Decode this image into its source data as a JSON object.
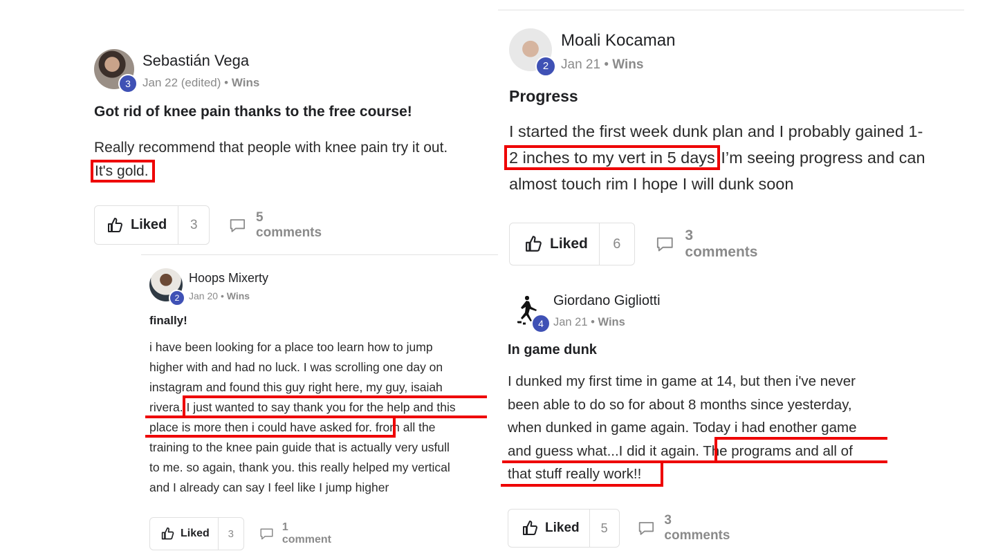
{
  "posts": [
    {
      "author": "Sebastián Vega",
      "level": "3",
      "date": "Jan 22 (edited)",
      "category": "Wins",
      "title": "Got rid of knee pain thanks to the free course!",
      "body_line1": "Really recommend that people with knee pain try it out.",
      "body_highlight": "It's gold.",
      "like_label": "Liked",
      "like_count": "3",
      "comments": "5 comments"
    },
    {
      "author": "Hoops Mixerty",
      "level": "2",
      "date": "Jan 20",
      "category": "Wins",
      "title": "finally!",
      "body_lines": [
        "i have been looking for a place too learn how to jump",
        "higher with and had no luck. I was scrolling one day on",
        "instagram and found this guy right here, my guy, isaiah"
      ],
      "body_l4_pre": "rivera.",
      "body_l4_hl": " I just wanted to say thank you for the help and this",
      "body_l5_hl": "place is more then i could have asked for.",
      "body_l5_post": " from all the",
      "body_lines_end": [
        "training to the knee pain guide that is actually very usfull",
        "to me. so again, thank you. this really helped my vertical",
        "and I already can say I feel like I jump higher"
      ],
      "like_label": "Liked",
      "like_count": "3",
      "comments": "1 comment"
    },
    {
      "author": "Moali Kocaman",
      "level": "2",
      "date": "Jan 21",
      "category": "Wins",
      "title": "Progress",
      "body_l1": "I started the first week dunk plan and I probably gained 1-",
      "body_l2_hl": "2 inches to my vert in 5 days",
      "body_l2_post": " I’m seeing progress and can",
      "body_l3": "almost touch rim I hope I will dunk soon",
      "like_label": "Liked",
      "like_count": "6",
      "comments": "3 comments"
    },
    {
      "author": "Giordano Gigliotti",
      "level": "4",
      "date": "Jan 21",
      "category": "Wins",
      "title": "In game dunk",
      "body_lines": [
        "I dunked my first time in game at 14, but then i've never",
        "been able to do so for about 8 months since yesterday,",
        "when dunked in game again. Today i had enother game"
      ],
      "body_l4_pre": "and guess what...I did it again.",
      "body_l4_hl": " The programs and all of",
      "body_l5_hl": "that stuff really work!!",
      "like_label": "Liked",
      "like_count": "5",
      "comments": "3 comments"
    }
  ],
  "sep": "•"
}
